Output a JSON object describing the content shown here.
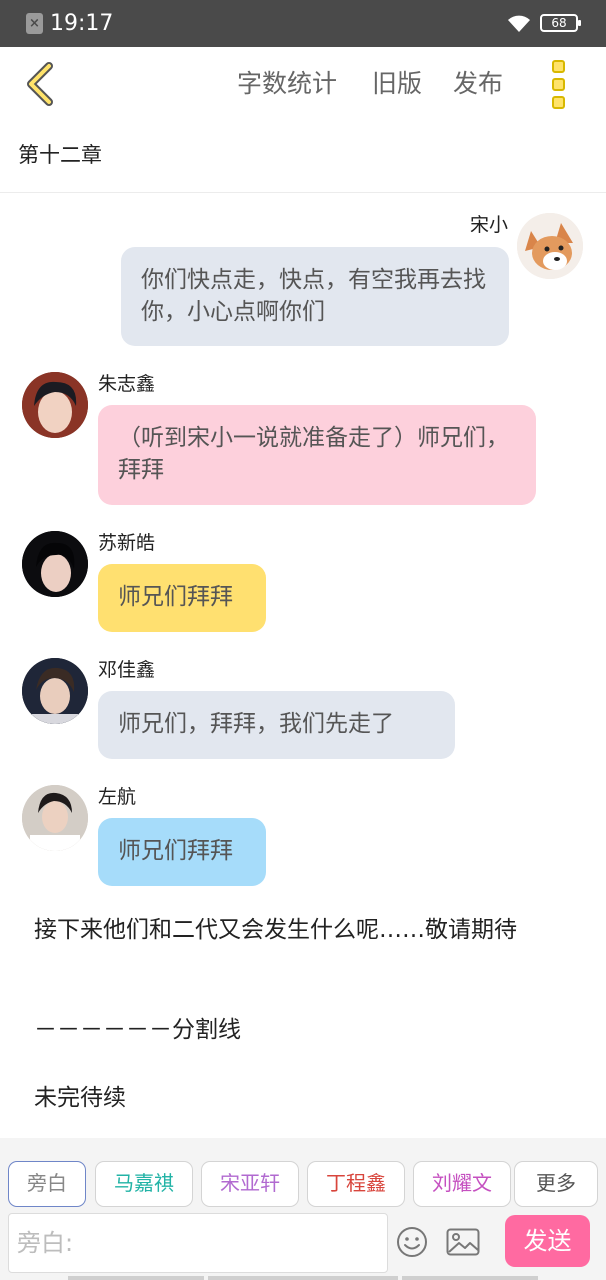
{
  "status_bar": {
    "time": "19:17",
    "battery": "68"
  },
  "toolbar": {
    "word_count": "字数统计",
    "old_version": "旧版",
    "publish": "发布"
  },
  "chapter": {
    "title": "第十二章"
  },
  "messages": [
    {
      "name": "宋小",
      "text": "你们快点走，快点，有空我再去找你，小心点啊你们",
      "side": "right",
      "bubble_color": "#e2e7ef"
    },
    {
      "name": "朱志鑫",
      "text": "（听到宋小一说就准备走了）师兄们，拜拜",
      "side": "left",
      "bubble_color": "#fdd0dc"
    },
    {
      "name": "苏新皓",
      "text": "师兄们拜拜",
      "side": "left",
      "bubble_color": "#ffe070"
    },
    {
      "name": "邓佳鑫",
      "text": "师兄们，拜拜，我们先走了",
      "side": "left",
      "bubble_color": "#e2e7ef"
    },
    {
      "name": "左航",
      "text": "师兄们拜拜",
      "side": "left",
      "bubble_color": "#a6dcfa"
    }
  ],
  "narration": [
    "接下来他们和二代又会发生什么呢……敬请期待",
    "－－－－－－分割线",
    "未完待续"
  ],
  "role_tabs": [
    {
      "label": "旁白",
      "color": "#888888"
    },
    {
      "label": "马嘉祺",
      "color": "#22b3a6"
    },
    {
      "label": "宋亚轩",
      "color": "#b16ad0"
    },
    {
      "label": "丁程鑫",
      "color": "#d8453c"
    },
    {
      "label": "刘耀文",
      "color": "#c550c0"
    },
    {
      "label": "更多",
      "color": "#555555"
    }
  ],
  "input": {
    "placeholder": "旁白:"
  },
  "send": {
    "label": "发送"
  },
  "icons": {
    "back": "chevron-left-icon",
    "more": "more-vertical-icon",
    "emoji": "smiley-icon",
    "image": "image-icon",
    "wifi": "wifi-icon",
    "battery": "battery-icon",
    "notification": "close-notification-icon"
  },
  "colors": {
    "accent_yellow": "#ffe36a",
    "send_pink": "#ff6aa1",
    "status_bar": "#4a4a4a"
  }
}
